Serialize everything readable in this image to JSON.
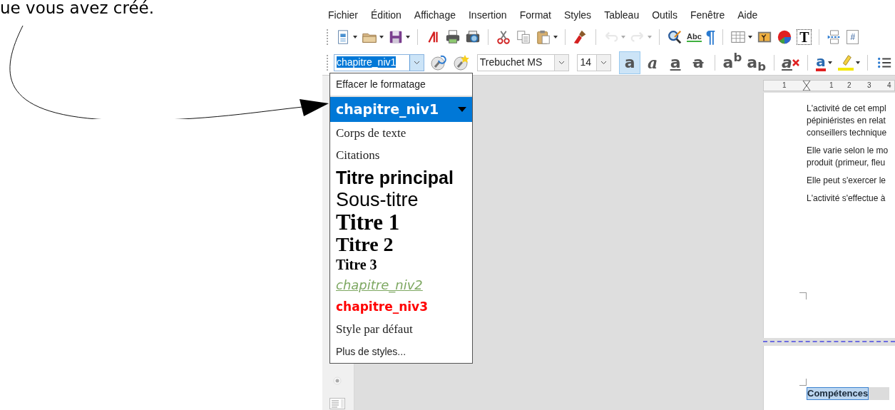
{
  "caption": "ue vous avez créé.",
  "menu": [
    "Fichier",
    "Édition",
    "Affichage",
    "Insertion",
    "Format",
    "Styles",
    "Tableau",
    "Outils",
    "Fenêtre",
    "Aide"
  ],
  "toolbar": [
    [
      {
        "kind": "new",
        "dropdown": true,
        "disabled": false
      },
      {
        "kind": "open",
        "dropdown": true,
        "disabled": false
      },
      {
        "kind": "save",
        "dropdown": true,
        "disabled": false
      }
    ],
    [
      {
        "kind": "pdf",
        "dropdown": false,
        "disabled": false
      },
      {
        "kind": "print",
        "dropdown": false,
        "disabled": false
      },
      {
        "kind": "preview",
        "dropdown": false,
        "disabled": false
      }
    ],
    [
      {
        "kind": "cut",
        "dropdown": false,
        "disabled": false
      },
      {
        "kind": "copy",
        "dropdown": false,
        "disabled": false
      },
      {
        "kind": "paste",
        "dropdown": true,
        "disabled": false
      }
    ],
    [
      {
        "kind": "brush",
        "dropdown": false,
        "disabled": false
      }
    ],
    [
      {
        "kind": "undo",
        "dropdown": true,
        "disabled": true
      },
      {
        "kind": "redo",
        "dropdown": true,
        "disabled": true
      }
    ],
    [
      {
        "kind": "find",
        "dropdown": false,
        "disabled": false
      },
      {
        "kind": "spelling",
        "glyph": "Abc",
        "dropdown": false,
        "disabled": false
      },
      {
        "kind": "pilcrow",
        "glyph": "¶",
        "dropdown": false,
        "disabled": false
      }
    ],
    [
      {
        "kind": "table",
        "dropdown": true,
        "disabled": false
      },
      {
        "kind": "image",
        "dropdown": false,
        "disabled": false
      },
      {
        "kind": "chart",
        "dropdown": false,
        "disabled": false
      },
      {
        "kind": "textbox",
        "glyph": "T",
        "dropdown": false,
        "disabled": false
      }
    ],
    [
      {
        "kind": "pagebreak",
        "dropdown": false,
        "disabled": false
      },
      {
        "kind": "field",
        "glyph": "#",
        "dropdown": false,
        "disabled": false
      }
    ]
  ],
  "paragraph_style": {
    "value": "chapitre_niv1"
  },
  "font_name": {
    "value": "Trebuchet MS"
  },
  "font_size": {
    "value": "14"
  },
  "format_buttons": [
    [
      {
        "kind": "bold",
        "glyph": "a",
        "selected": true
      },
      {
        "kind": "italic",
        "glyph": "a",
        "selected": false
      },
      {
        "kind": "underline",
        "glyph": "a",
        "selected": false
      },
      {
        "kind": "strike",
        "glyph": "a",
        "selected": false
      }
    ],
    [
      {
        "kind": "superscript",
        "glyph": "a$^{b}$",
        "selected": false
      },
      {
        "kind": "subscript",
        "glyph": "a$_{b}$",
        "selected": false
      }
    ],
    [
      {
        "kind": "clear",
        "glyph": "a",
        "selected": false
      }
    ],
    [
      {
        "kind": "fontcolor",
        "glyph": "a",
        "selected": false,
        "color": "#e02020"
      },
      {
        "kind": "highlight",
        "selected": false,
        "color": "#f4e800"
      }
    ],
    [
      {
        "kind": "list",
        "selected": false
      }
    ]
  ],
  "style_list": [
    {
      "kind": "plain",
      "label": "Effacer le formatage",
      "selected": false
    },
    {
      "kind": "chapter1",
      "label": "chapitre_niv1",
      "selected": true
    },
    {
      "kind": "body",
      "label": "Corps de texte",
      "selected": false
    },
    {
      "kind": "body",
      "label": "Citations",
      "selected": false
    },
    {
      "kind": "title",
      "label": "Titre principal",
      "selected": false
    },
    {
      "kind": "subtitle",
      "label": "Sous-titre",
      "selected": false
    },
    {
      "kind": "heading1",
      "label": "Titre 1",
      "selected": false
    },
    {
      "kind": "heading2",
      "label": "Titre 2",
      "selected": false
    },
    {
      "kind": "heading3",
      "label": "Titre 3",
      "selected": false
    },
    {
      "kind": "chapter2",
      "label": "chapitre_niv2",
      "selected": false,
      "color": "#7ea862"
    },
    {
      "kind": "chapter3",
      "label": "chapitre_niv3",
      "selected": false,
      "color": "#ff0000"
    },
    {
      "kind": "body",
      "label": "Style par défaut",
      "selected": false
    },
    {
      "kind": "plain",
      "label": "Plus de styles...",
      "selected": false
    }
  ],
  "ruler": [
    "1",
    "1",
    "2",
    "3",
    "4"
  ],
  "page": {
    "paragraphs": [
      [
        "L'activité de cet empl",
        "pépiniéristes en relat",
        "conseillers technique"
      ],
      [
        "Elle varie selon le mo",
        "produit (primeur, fleu"
      ],
      [
        "Elle peut s'exercer le"
      ],
      [
        "L'activité s'effectue à"
      ]
    ]
  },
  "page2": {
    "heading": "Compétences"
  }
}
